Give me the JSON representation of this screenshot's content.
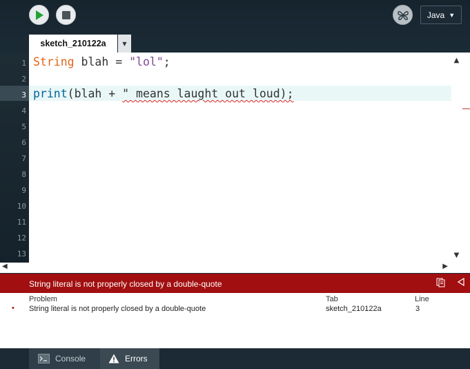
{
  "toolbar": {
    "run_icon": "play-icon",
    "stop_icon": "stop-icon",
    "mode_icon": "butterfly-icon",
    "mode_label": "Java",
    "accent_green": "#25a236"
  },
  "tabs": [
    {
      "label": "sketch_210122a"
    }
  ],
  "editor": {
    "line_numbers": [
      "1",
      "2",
      "3",
      "4",
      "5",
      "6",
      "7",
      "8",
      "9",
      "10",
      "11",
      "12",
      "13"
    ],
    "current_line": 3,
    "code": {
      "line1": {
        "type": "String",
        "rest": " blah = ",
        "string": "\"lol\"",
        "end": ";"
      },
      "line3": {
        "fn": "print",
        "mid": "(blah + ",
        "error_text": "\" means laught out loud);"
      }
    }
  },
  "error_bar": {
    "message": "String literal is not properly closed by a double-quote",
    "color": "#a10f10"
  },
  "problems": {
    "headers": {
      "problem": "Problem",
      "tab": "Tab",
      "line": "Line"
    },
    "rows": [
      {
        "problem": "String literal is not properly closed by a double-quote",
        "tab": "sketch_210122a",
        "line": "3"
      }
    ]
  },
  "bottom_tabs": {
    "console": "Console",
    "errors": "Errors"
  }
}
